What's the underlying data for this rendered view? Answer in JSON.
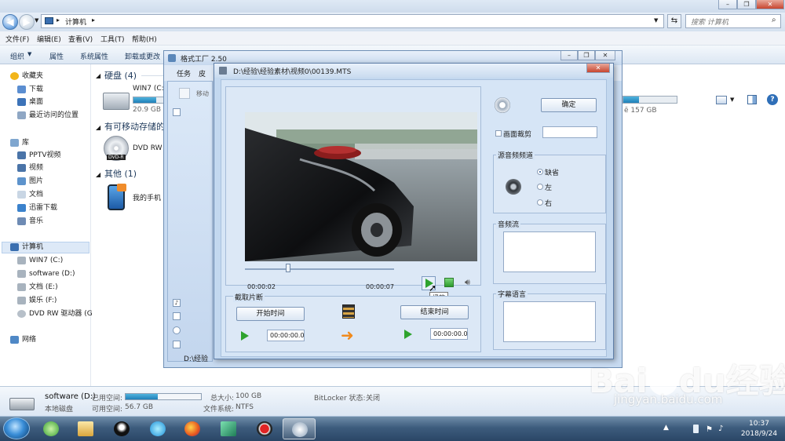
{
  "explorer": {
    "address_path": "计算机",
    "search_placeholder": "搜索 计算机",
    "menus": [
      "文件(F)",
      "编辑(E)",
      "查看(V)",
      "工具(T)",
      "帮助(H)"
    ],
    "toolbar": [
      "组织",
      "属性",
      "系统属性",
      "卸载或更改"
    ],
    "nav": {
      "favorites": "收藏夹",
      "fav_items": [
        "下载",
        "桌面",
        "最近访问的位置"
      ],
      "library": "库",
      "lib_items": [
        "PPTV视频",
        "视频",
        "图片",
        "文档",
        "迅雷下载",
        "音乐"
      ],
      "computer": "计算机",
      "computer_items": [
        "WIN7 (C:)",
        "software (D:)",
        "文档 (E:)",
        "娱乐 (F:)",
        "DVD RW 驱动器 (G"
      ],
      "network": "网络"
    },
    "groups": {
      "hdd": "硬盘 (4)",
      "removable": "有可移动存储的",
      "other": "其他 (1)"
    },
    "drives": {
      "c_label": "WIN7 (C:",
      "c_free": "20.9 GB",
      "c_usage": 0.72,
      "right_free": "ē 157 GB",
      "dvd_label": "DVD RW",
      "phone_label": "我的手机"
    }
  },
  "details": {
    "drive_name": "software (D:)",
    "drive_type": "本地磁盘",
    "used_label": "已用空间:",
    "free_label": "可用空间:",
    "free_value": "56.7 GB",
    "used_fraction": 0.43,
    "total_label": "总大小:",
    "total_value": "100 GB",
    "fs_label": "文件系统:",
    "fs_value": "NTFS",
    "bitlocker_label": "BitLocker 状态:",
    "bitlocker_value": "关闭"
  },
  "ff": {
    "title": "格式工厂 2.50",
    "tabs": [
      "任务",
      "皮"
    ],
    "task_item": "移动",
    "status_path": "D:\\经验"
  },
  "dialog": {
    "title": "D:\\经验\\经验素材\\视频0\\00139.MTS",
    "ok_button": "确定",
    "crop_label": "画面裁剪",
    "time_start": "00:00:02",
    "time_end": "00:00:07",
    "play_tooltip": "播放",
    "clip_section": "截取片断",
    "start_time_button": "开始时间",
    "end_time_button": "结束时间",
    "start_value": "00:00:00.00",
    "end_value": "00:00:00.00",
    "audio_channel": "源音频频道",
    "channel_options": [
      "缺省",
      "左",
      "右"
    ],
    "selected_channel": "缺省",
    "audio_stream": "音频流",
    "subtitle_language": "字幕语言"
  },
  "taskbar": {
    "time": "10:37",
    "date": "2018/9/24"
  },
  "watermark": {
    "brand_a": "Bai",
    "brand_b": "du",
    "brand_c": "经验",
    "url": "jingyan.baidu.com"
  }
}
